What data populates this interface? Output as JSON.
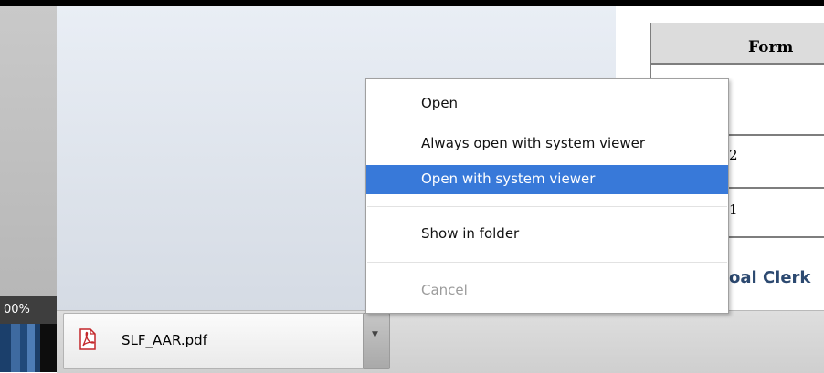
{
  "viewer": {
    "zoom": "00%"
  },
  "page": {
    "table_header": "Form",
    "row_values": [
      "2",
      "1"
    ],
    "section_heading": "oal Clerk"
  },
  "download": {
    "filename": "SLF_AAR.pdf",
    "icon": "pdf-icon",
    "arrow_icon": "chevron-down-icon"
  },
  "context_menu": {
    "items": [
      {
        "label": "Open",
        "state": "normal"
      },
      {
        "label": "Always open with system viewer",
        "state": "normal"
      },
      {
        "label": "Open with system viewer",
        "state": "highlighted"
      },
      {
        "label": "Show in folder",
        "state": "normal"
      },
      {
        "label": "Cancel",
        "state": "disabled"
      }
    ]
  },
  "colors": {
    "highlight": "#3879d9",
    "heading": "#2c4970",
    "pdf_red": "#c3272b"
  }
}
